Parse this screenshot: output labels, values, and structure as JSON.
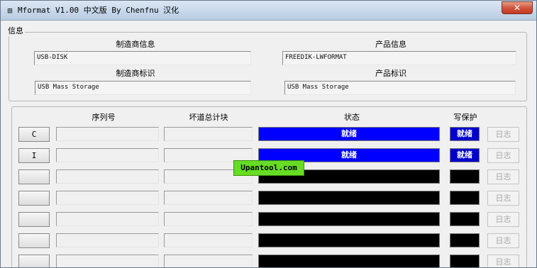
{
  "window": {
    "title": "Mformat V1.00 中文版 By Chenfnu 汉化",
    "close_label": "✕"
  },
  "info": {
    "group_label": "信息",
    "manufacturer_info_label": "制造商信息",
    "manufacturer_info_value": "USB-DISK",
    "product_info_label": "产品信息",
    "product_info_value": "FREEDIK-LWFORMAT",
    "manufacturer_id_label": "制造商标识",
    "manufacturer_id_value": "USB Mass Storage",
    "product_id_label": "产品标识",
    "product_id_value": "USB Mass Storage"
  },
  "drives": {
    "headers": {
      "serial": "序列号",
      "bad_blocks": "坏道总计块",
      "status": "状态",
      "write_protect": "写保护"
    },
    "log_label": "日志",
    "rows": [
      {
        "letter": "C",
        "status": "就绪",
        "write_protect": "就绪",
        "ready": true
      },
      {
        "letter": "I",
        "status": "就绪",
        "write_protect": "就绪",
        "ready": true
      },
      {
        "letter": "",
        "status": "",
        "write_protect": "",
        "ready": false
      },
      {
        "letter": "",
        "status": "",
        "write_protect": "",
        "ready": false
      },
      {
        "letter": "",
        "status": "",
        "write_protect": "",
        "ready": false
      },
      {
        "letter": "",
        "status": "",
        "write_protect": "",
        "ready": false
      },
      {
        "letter": "",
        "status": "",
        "write_protect": "",
        "ready": false
      }
    ]
  },
  "watermark": "Upantool.com",
  "colors": {
    "status_ready": "#0000ff",
    "status_idle": "#000000",
    "watermark_bg": "#66dd22"
  }
}
